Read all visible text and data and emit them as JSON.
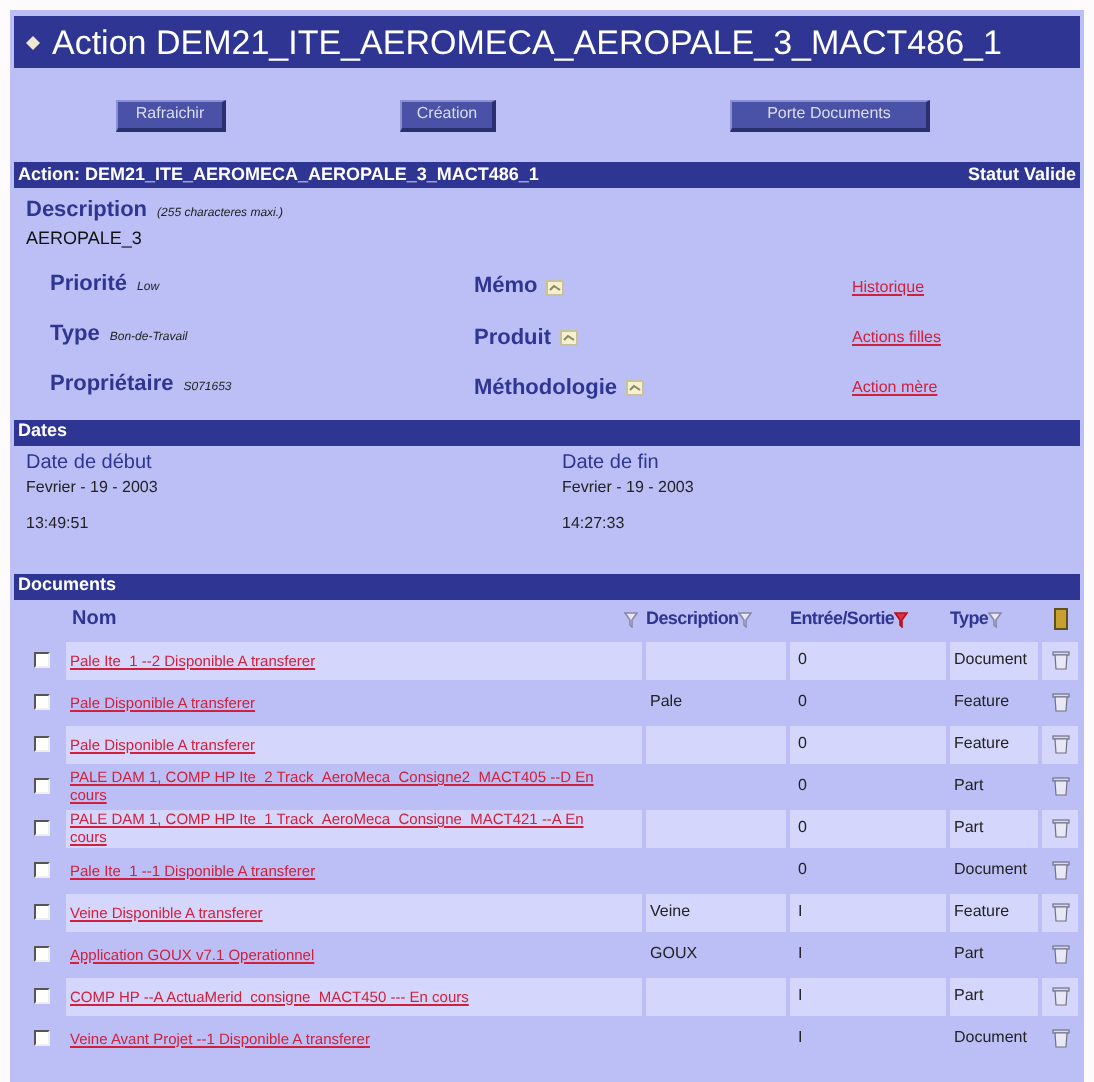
{
  "window": {
    "title": "Action DEM21_ITE_AEROMECA_AEROPALE_3_MACT486_1"
  },
  "buttons": [
    "Rafraichir",
    "Création",
    "Porte Documents"
  ],
  "action_bar": {
    "label": "Action: DEM21_ITE_AEROMECA_AEROPALE_3_MACT486_1",
    "status": "Statut Valide"
  },
  "description": {
    "label": "Description",
    "hint": "(255 characteres maxi.)",
    "value": "AEROPALE_3"
  },
  "fields": [
    {
      "label": "Priorité",
      "value": "Low"
    },
    {
      "label": "Type",
      "value": "Bon-de-Travail"
    },
    {
      "label": "Propriétaire",
      "value": "S071653"
    }
  ],
  "notes": [
    "Mémo",
    "Produit",
    "Méthodologie"
  ],
  "links": [
    "Historique",
    "Actions filles",
    "Action mère"
  ],
  "dates": {
    "title": "Dates",
    "columns": [
      {
        "label": "Date de début",
        "date": "Fevrier - 19 - 2003",
        "time": "13:49:51"
      },
      {
        "label": "Date de fin",
        "date": "Fevrier - 19 - 2003",
        "time": "14:27:33"
      }
    ]
  },
  "documents": {
    "title": "Documents",
    "columns": [
      {
        "label": "Nom",
        "filter_active": false
      },
      {
        "label": "Description",
        "filter_active": false
      },
      {
        "label": "Entrée/Sortie",
        "filter_active": true
      },
      {
        "label": "Type",
        "filter_active": false
      }
    ],
    "rows": [
      {
        "checked": false,
        "name": "Pale Ite_1 --2 Disponible A transferer",
        "description": "",
        "io": "0",
        "type": "Document"
      },
      {
        "checked": false,
        "name": "Pale Disponible A transferer",
        "description": "Pale",
        "io": "0",
        "type": "Feature"
      },
      {
        "checked": false,
        "name": "Pale Disponible A transferer",
        "description": "",
        "io": "0",
        "type": "Feature"
      },
      {
        "checked": false,
        "name": "PALE DAM 1, COMP HP Ite_2 Track_AeroMeca_Consigne2_MACT405 --D En cours",
        "description": "",
        "io": "0",
        "type": "Part"
      },
      {
        "checked": false,
        "name": "PALE DAM 1, COMP HP Ite_1 Track_AeroMeca_Consigne_MACT421 --A En cours",
        "description": "",
        "io": "0",
        "type": "Part"
      },
      {
        "checked": false,
        "name": "Pale Ite_1 --1 Disponible A transferer",
        "description": "",
        "io": "0",
        "type": "Document"
      },
      {
        "checked": false,
        "name": "Veine Disponible A transferer",
        "description": "Veine",
        "io": "I",
        "type": "Feature"
      },
      {
        "checked": false,
        "name": "Application GOUX v7.1 Operationnel",
        "description": "GOUX",
        "io": "I",
        "type": "Part"
      },
      {
        "checked": false,
        "name": "COMP HP --A ActuaMerid_consigne_MACT450 --- En cours",
        "description": "",
        "io": "I",
        "type": "Part"
      },
      {
        "checked": false,
        "name": "Veine Avant Projet --1 Disponible A transferer",
        "description": "",
        "io": "I",
        "type": "Document"
      }
    ]
  }
}
